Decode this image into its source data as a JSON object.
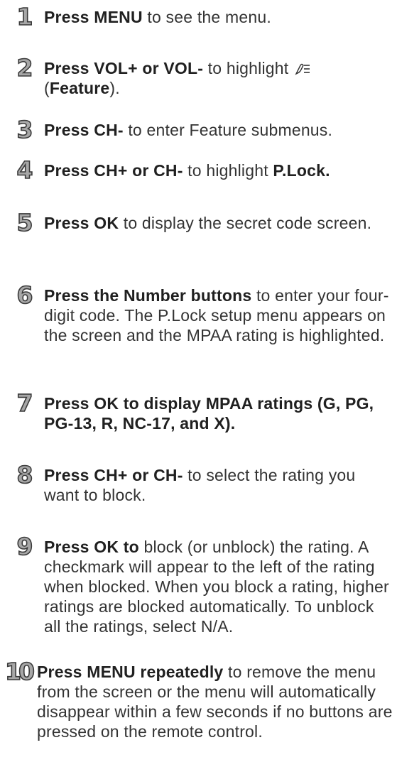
{
  "steps": [
    {
      "number": "1",
      "bold": "Press MENU",
      "text": " to see the menu."
    },
    {
      "number": "2",
      "bold": "Press VOL+ or VOL-",
      "text": " to highlight ",
      "icon": "feature-icon",
      "paren_open": "(",
      "bold2": "Feature",
      "paren_close": ")."
    },
    {
      "number": "3",
      "bold": "Press CH-",
      "text": " to enter Feature submenus."
    },
    {
      "number": "4",
      "bold": "Press CH+ or CH-",
      "text": " to highlight ",
      "bold2": "P.Lock."
    },
    {
      "number": "5",
      "bold": "Press OK",
      "text": " to display the secret code screen."
    },
    {
      "number": "6",
      "bold": "Press the Number buttons",
      "text": " to enter your four-digit code. The P.Lock setup menu appears on the screen and the MPAA rating is highlighted."
    },
    {
      "number": "7",
      "bold": "Press OK to display MPAA ratings (G, PG, PG-13, R, NC-17, and X)."
    },
    {
      "number": "8",
      "bold": "Press CH+ or CH-",
      "text": " to select the rating you want to block."
    },
    {
      "number": "9",
      "bold": "Press OK to",
      "text": " block (or unblock) the rating. A checkmark will appear to the left of the rating when blocked. When you block a rating, higher ratings are blocked automatically. To unblock all the ratings, select N/A."
    },
    {
      "number": "10",
      "bold": "Press MENU repeatedly",
      "text": " to remove the menu from the screen or the menu will automatically disappear within a few seconds if no buttons are pressed on the remote control."
    }
  ]
}
